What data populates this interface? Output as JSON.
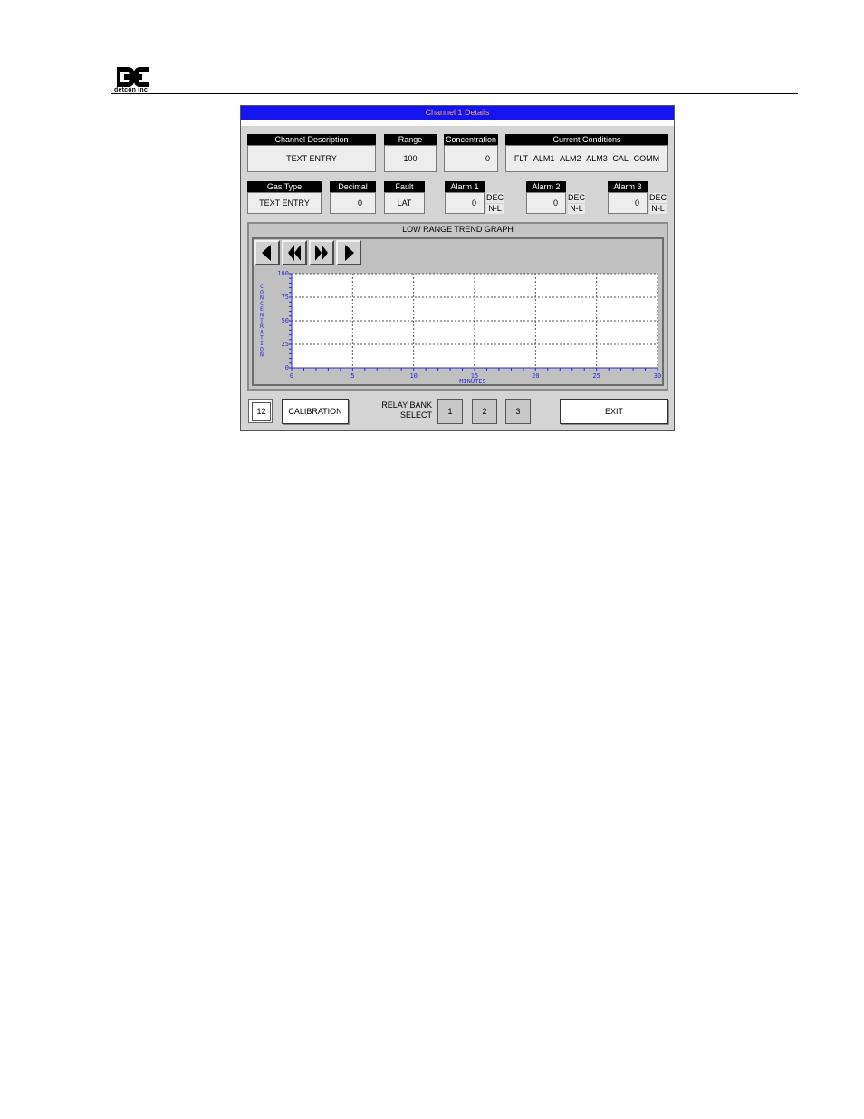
{
  "header": {
    "logo_text": "detcon inc"
  },
  "window": {
    "title": "Channel 1 Details"
  },
  "row1": {
    "channel_description": {
      "label": "Channel Description",
      "value": "TEXT ENTRY"
    },
    "range": {
      "label": "Range",
      "value": "100"
    },
    "concentration": {
      "label": "Concentration",
      "value": "0"
    },
    "current_conditions": {
      "label": "Current Conditions",
      "items": [
        "FLT",
        "ALM1",
        "ALM2",
        "ALM3",
        "CAL",
        "COMM"
      ]
    }
  },
  "row2": {
    "gas_type": {
      "label": "Gas Type",
      "value": "TEXT ENTRY"
    },
    "decimal": {
      "label": "Decimal",
      "value": "0"
    },
    "fault": {
      "label": "Fault",
      "value": "LAT"
    },
    "alarm1": {
      "label": "Alarm 1",
      "value": "0",
      "dir": "DEC",
      "latch": "N-L"
    },
    "alarm2": {
      "label": "Alarm 2",
      "value": "0",
      "dir": "DEC",
      "latch": "N-L"
    },
    "alarm3": {
      "label": "Alarm 3",
      "value": "0",
      "dir": "DEC",
      "latch": "N-L"
    }
  },
  "graph": {
    "title": "LOW RANGE TREND GRAPH",
    "nav_icons": [
      "triangle-left-icon",
      "double-chevron-left-icon",
      "double-chevron-right-icon",
      "triangle-right-icon"
    ]
  },
  "chart_data": {
    "type": "line",
    "title": "LOW RANGE TREND GRAPH",
    "xlabel": "MINUTES",
    "ylabel": "CONCENTRATION",
    "x_ticks": [
      "0",
      "5",
      "10",
      "15",
      "20",
      "25",
      "30"
    ],
    "y_ticks": [
      "0",
      "25",
      "50",
      "75",
      "100"
    ],
    "xlim": [
      0,
      30
    ],
    "ylim": [
      0,
      100
    ],
    "grid": true,
    "series": [],
    "colors": {
      "axis": "#2a2ad0",
      "grid": "#555555",
      "plot_bg": "#ffffff"
    }
  },
  "bottom": {
    "channel_number": "12",
    "calibration_label": "CALIBRATION",
    "relay_bank_line1": "RELAY BANK",
    "relay_bank_line2": "SELECT",
    "relay_buttons": [
      "1",
      "2",
      "3"
    ],
    "exit_label": "EXIT"
  }
}
